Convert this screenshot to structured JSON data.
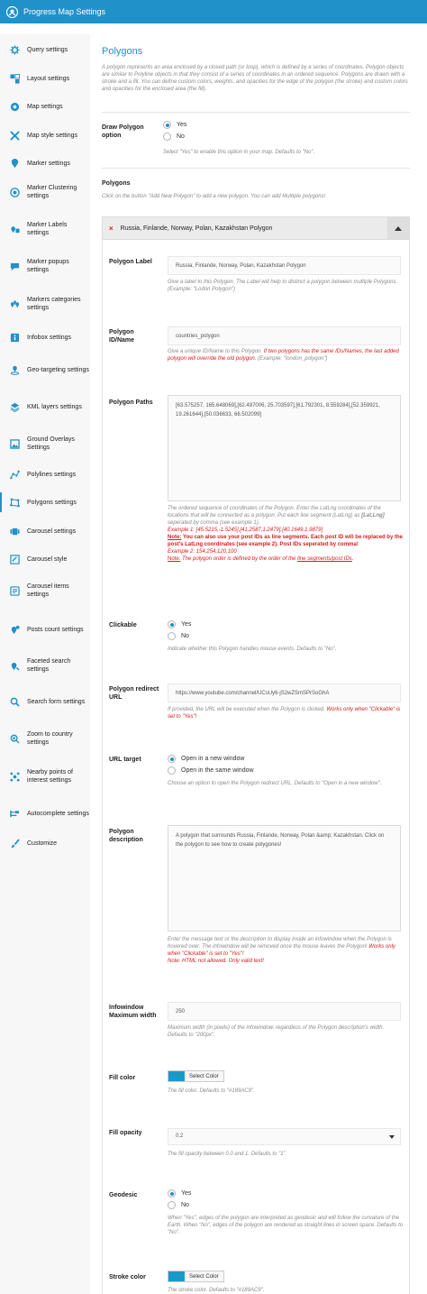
{
  "app": {
    "title": "Progress Map Settings"
  },
  "sidebar": {
    "items": [
      {
        "label": "Query settings",
        "icon": "gear-icon"
      },
      {
        "label": "Layout settings",
        "icon": "layout-icon"
      },
      {
        "label": "Map settings",
        "icon": "map-settings-icon"
      },
      {
        "label": "Map style settings",
        "icon": "map-style-icon"
      },
      {
        "label": "Marker settings",
        "icon": "marker-icon"
      },
      {
        "label": "Marker Clustering settings",
        "icon": "cluster-icon"
      },
      {
        "label": "Marker Labels settings",
        "icon": "marker-label-icon"
      },
      {
        "label": "Marker popups settings",
        "icon": "popup-icon"
      },
      {
        "label": "Markers categories settings",
        "icon": "categories-icon"
      },
      {
        "label": "Infobox settings",
        "icon": "infobox-icon"
      },
      {
        "label": "Geo-targeting settings",
        "icon": "geo-target-icon"
      },
      {
        "label": "KML layers settings",
        "icon": "layers-icon"
      },
      {
        "label": "Ground Overlays Settings",
        "icon": "overlay-icon"
      },
      {
        "label": "Polylines settings",
        "icon": "polyline-icon"
      },
      {
        "label": "Polygons settings",
        "icon": "polygon-icon"
      },
      {
        "label": "Carousel settings",
        "icon": "carousel-icon"
      },
      {
        "label": "Carousel style",
        "icon": "carousel-style-icon"
      },
      {
        "label": "Carousel items settings",
        "icon": "carousel-items-icon"
      },
      {
        "label": "Posts count settings",
        "icon": "posts-count-icon"
      },
      {
        "label": "Faceted search settings",
        "icon": "faceted-search-icon"
      },
      {
        "label": "Search form settings",
        "icon": "search-icon"
      },
      {
        "label": "Zoom to country settings",
        "icon": "zoom-country-icon"
      },
      {
        "label": "Nearby points of interest settings",
        "icon": "nearby-icon"
      },
      {
        "label": "Autocomplete settings",
        "icon": "autocomplete-icon"
      },
      {
        "label": "Customize",
        "icon": "brush-icon"
      }
    ],
    "active_index": 14
  },
  "main": {
    "title": "Polygons",
    "intro": "A polygon represents an area enclosed by a closed path (or loop), which is defined by a series of coordinates. Polygon objects are similar to Polyline objects in that they consist of a series of coordinates in an ordered sequence. Polygons are drawn with a stroke and a fill. You can define custom colors, weights, and opacities for the edge of the polygon (the stroke) and custom colors and opacities for the enclosed area (the fill).",
    "draw_polygon": {
      "label": "Draw Polygon option",
      "options": [
        "Yes",
        "No"
      ],
      "selected": "Yes",
      "help": "Select \"Yes\" to enable this option in your map. Defaults to \"No\"."
    },
    "polygons_section": {
      "heading": "Polygons",
      "help": "Click on the button \"Add New Polygon\" to add a new polygon. You can add Multiple polygons!"
    },
    "panel": {
      "title": "Russia, Finlande, Norway, Polan, Kazakhstan Polygon",
      "remove_symbol": "×",
      "polygon_label": {
        "label": "Polygon Label",
        "value": "Russia, Finlande, Norway, Polan, Kazakhstan Polygon",
        "help": "Give a label to this Polygon. The Label will help to distinct a polygon between multiple Polygons. (Example: \"Lodon Polygon\")"
      },
      "polygon_id": {
        "label": "Polygon ID/Name",
        "value": "countries_polygon",
        "help_1": "Give a unique ID/Name to this Polygon.",
        "help_red": "If two polygons has the same IDs/Names, the last added polygon will override the old polygon.",
        "help_2": "(Example: \"london_polygon\")"
      },
      "polygon_paths": {
        "label": "Polygon Paths",
        "value": "[63.575257, 165.648069],[62.497006, 25.703597],[61.792301, 8.559284],[52.359921, 19.261644],[50.036633, 66.502099]",
        "help_1": "The ordered sequence of coordinates of the Polygon. Enter the LatLng coordinates of the locations that will be connected as a polygon. Put each line segment (LatLng) as",
        "help_bold": "[Lat,Lng]",
        "help_2": "seperated by comma (see example 1).",
        "example_1": "Example 1: [45.5215,-1.5245],[41.2587,1.2479],[40.1649,1.9879]",
        "note_label": "Note:",
        "note_1_rest": "You can also use your post IDs as line segments. Each post ID will be replaced by the post's LatLng coordinates (see example 2). Post IDs seperated by comma!",
        "example_2": "Example 2: 154,254,120,100",
        "note_2_pre": "The polygon order is defined by the order of the",
        "note_2_link": "line segments/post IDs",
        "note_2_end": "."
      },
      "clickable": {
        "label": "Clickable",
        "options": [
          "Yes",
          "No"
        ],
        "selected": "Yes",
        "help": "Indicate whether this Polygon handles mouse events. Defaults to \"No\"."
      },
      "redirect_url": {
        "label": "Polygon redirect URL",
        "value": "https://www.youtube.com/channel/UCsUy6-jS2wZSmSPrSoGhA",
        "help_1": "If provided, the URL will be executed when the Polygon is clicked.",
        "help_red": "Works only when \"Clickable\" is set to \"Yes\"!"
      },
      "url_target": {
        "label": "URL target",
        "options": [
          "Open in a new window",
          "Open in the same window"
        ],
        "selected": "Open in a new window",
        "help": "Choose an option to open the Polygon redirect URL. Defaults to \"Open in a new window\"."
      },
      "description": {
        "label": "Polygon description",
        "value": "A polygon that surrounds Russia, Finlande, Norway, Polan &amp; Kazakhstan. Click on the polygon to see how to create polygones!",
        "help_1": "Enter the message text or the description to display inside an infowindow when the Polygon is hovered over. The infowindow will be removed once the mouse leaves the Polygon!",
        "help_red_1": "Works only when \"Clickable\" is set to \"Yes\"!",
        "help_red_2": "Note: HTML not allowed. Only valid text!"
      },
      "infowindow_width": {
        "label": "Infowindow Maximum width",
        "value": "250",
        "help": "Maximum width (in pixels) of the infowindow, regardless of the Polygon description's width. Defaults to \"200px\"."
      },
      "fill_color": {
        "label": "Fill color",
        "button": "Select Color",
        "swatch": "#189AC9",
        "help": "The fill color. Defaults to \"#189AC9\"."
      },
      "fill_opacity": {
        "label": "Fill opacity",
        "value": "0.2",
        "help": "The fill opacity between 0.0 and 1. Defaults to \"1\"."
      },
      "geodesic": {
        "label": "Geodesic",
        "options": [
          "Yes",
          "No"
        ],
        "selected": "Yes",
        "help": "When \"Yes\", edges of the polygon are interpreted as geodesic and will follow the curvature of the Earth. When \"No\", edges of the polygon are rendered as straight lines in screen space. Defaults to \"No\"."
      },
      "stroke_color": {
        "label": "Stroke color",
        "button": "Select Color",
        "help": "The stroke color. Defaults to \"#189AC9\"."
      }
    }
  },
  "colors": {
    "accent": "#2191c9",
    "red": "#d81c1c",
    "swatch": "#189ac9"
  }
}
